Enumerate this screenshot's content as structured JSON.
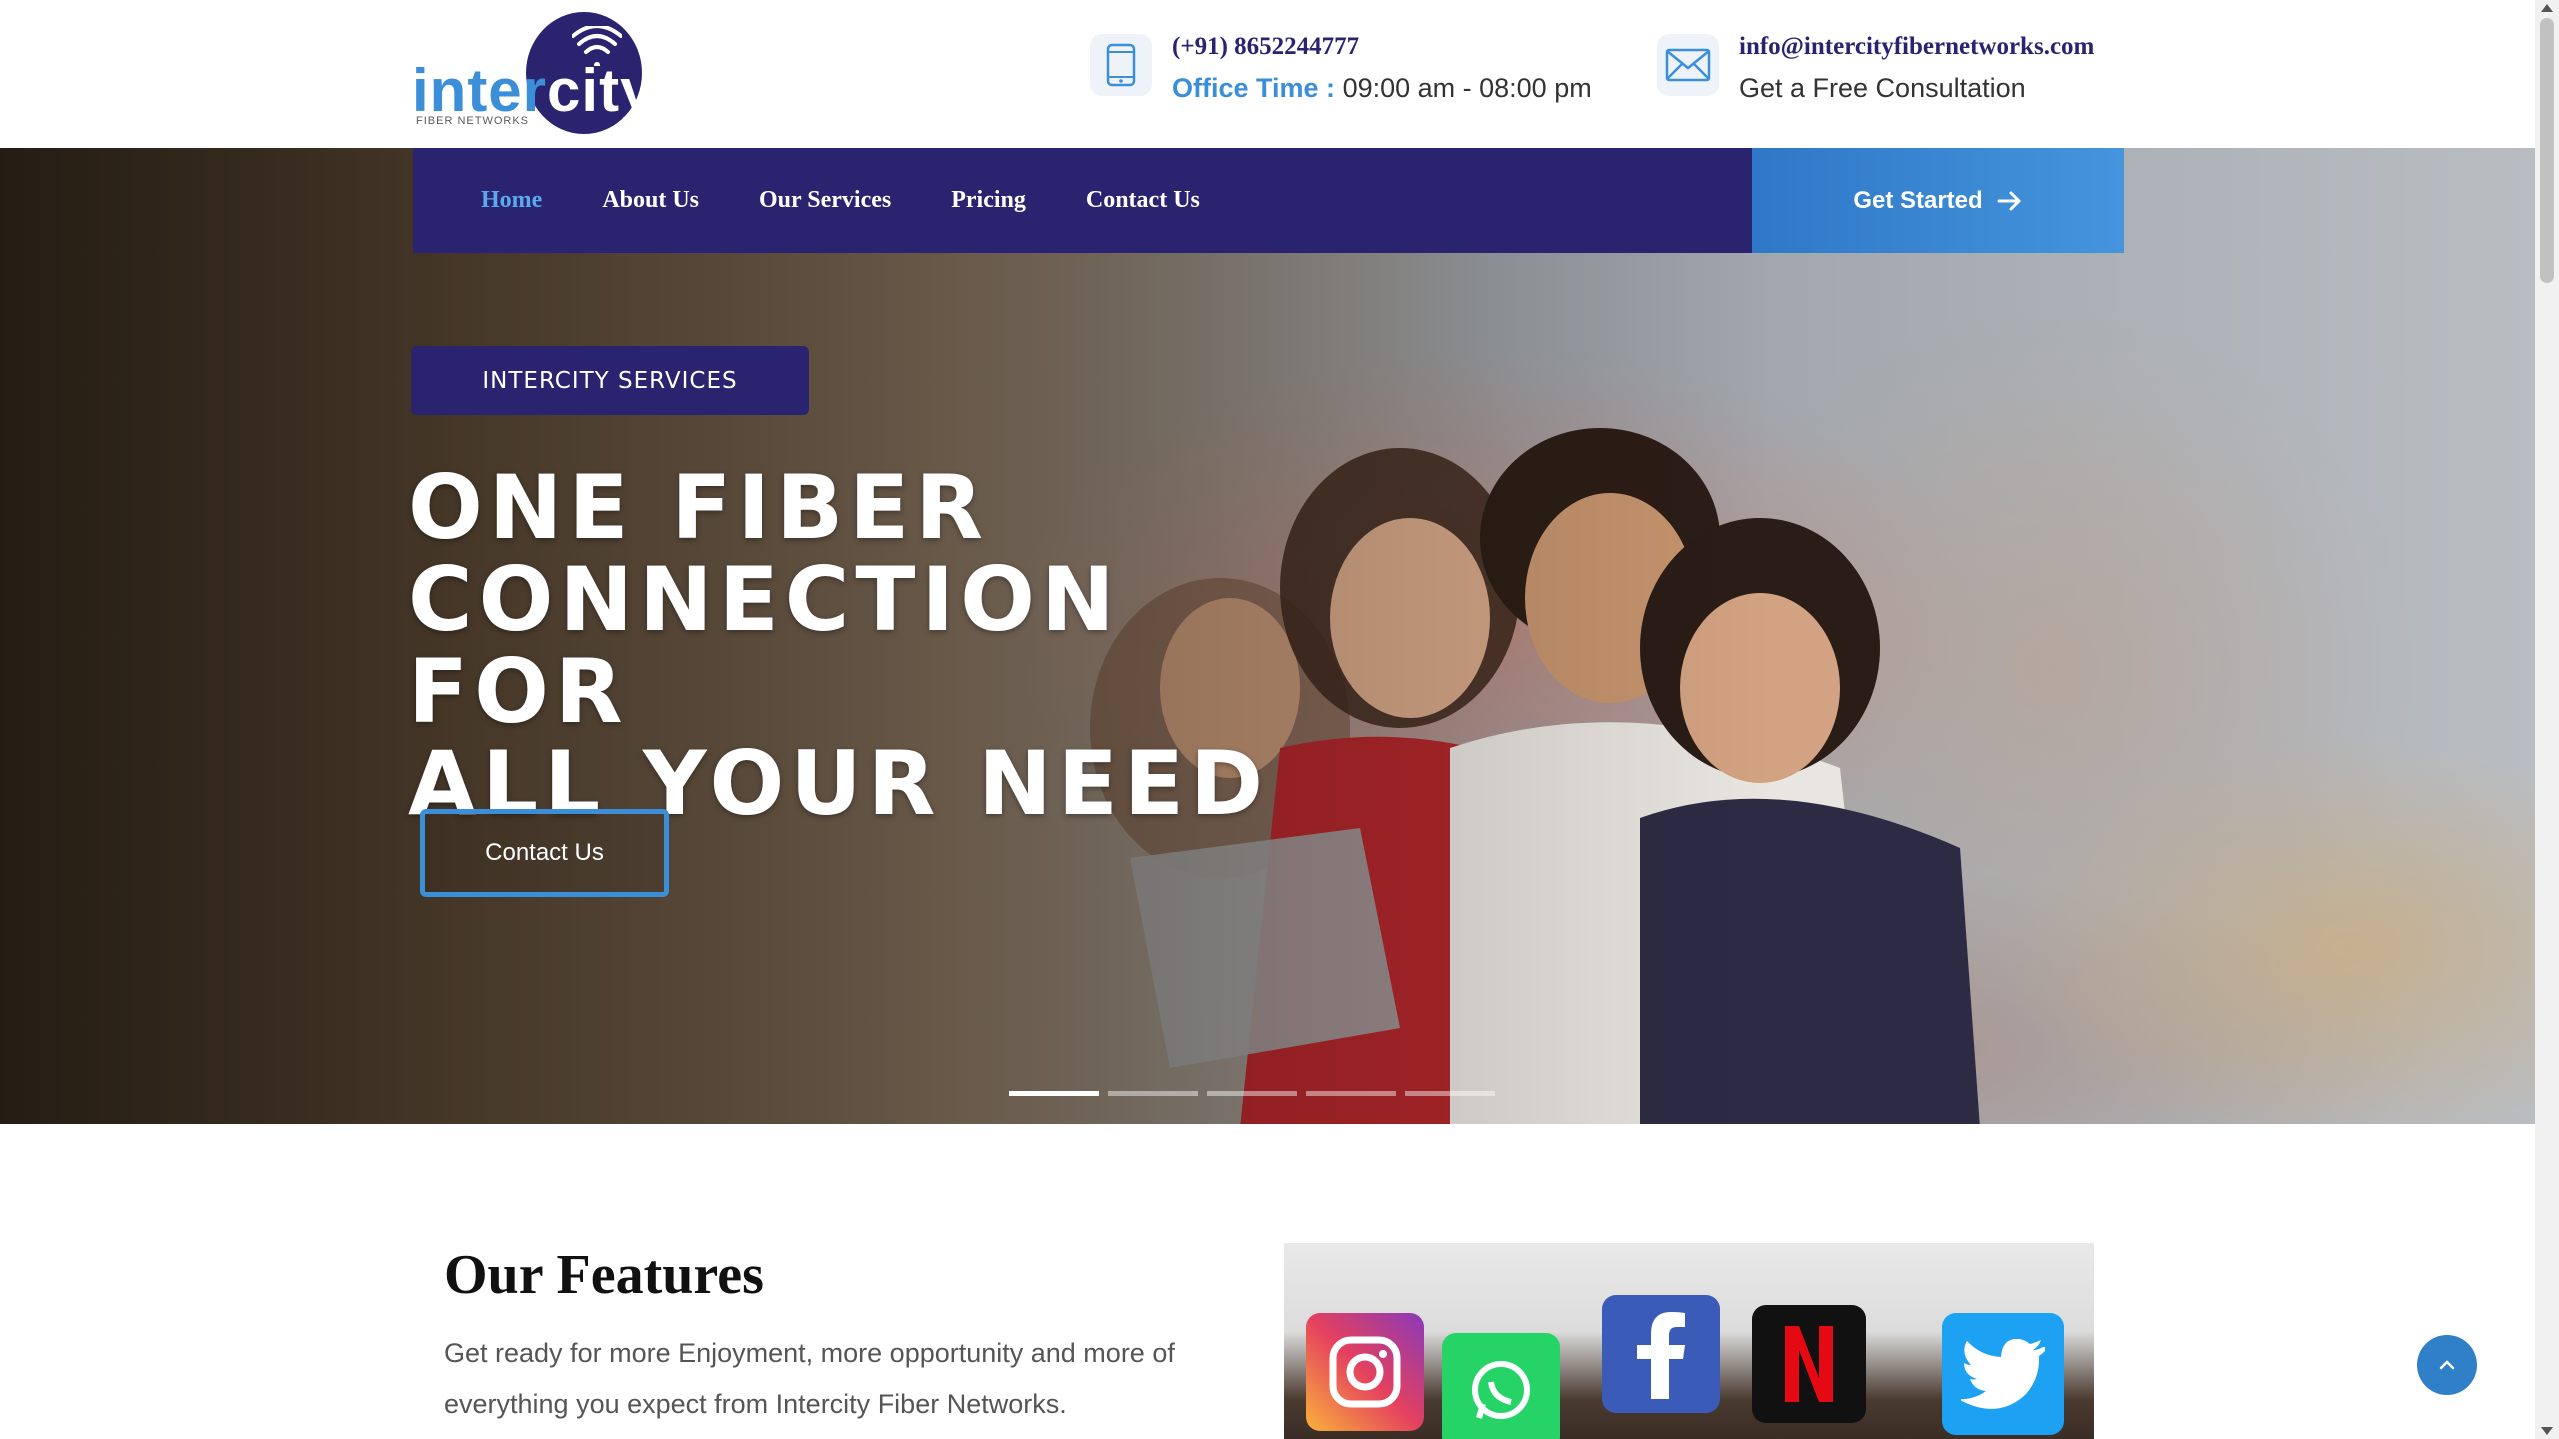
{
  "brand": {
    "name_part1": "inter",
    "name_part2": "city",
    "tagline": "FIBER NETWORKS",
    "primary_color": "#2a2370",
    "accent_color": "#3a8fd8"
  },
  "header": {
    "phone": {
      "icon": "phone-icon",
      "number": "(+91) 8652244777",
      "office_label": "Office Time :",
      "office_hours": "09:00 am - 08:00 pm"
    },
    "email": {
      "icon": "envelope-icon",
      "address": "info@intercityfibernetworks.com",
      "sub": "Get a Free Consultation"
    }
  },
  "nav": {
    "items": [
      {
        "label": "Home",
        "active": true
      },
      {
        "label": "About Us",
        "active": false
      },
      {
        "label": "Our Services",
        "active": false
      },
      {
        "label": "Pricing",
        "active": false
      },
      {
        "label": "Contact Us",
        "active": false
      }
    ],
    "cta_label": "Get Started",
    "cta_icon": "arrow-right-icon"
  },
  "hero": {
    "badge": "INTERCITY SERVICES",
    "headline_lines": [
      "ONE FIBER",
      "CONNECTION FOR",
      "ALL YOUR NEED"
    ],
    "cta_label": "Contact Us",
    "slides_total": 5,
    "slide_active": 1
  },
  "features": {
    "title": "Our Features",
    "description": "Get ready for more Enjoyment, more opportunity and more of everything you expect from Intercity Fiber Networks.",
    "image_icons": [
      "instagram-icon",
      "whatsapp-icon",
      "facebook-icon",
      "netflix-icon",
      "twitter-icon"
    ]
  },
  "scroll_top_icon": "chevron-up-icon"
}
